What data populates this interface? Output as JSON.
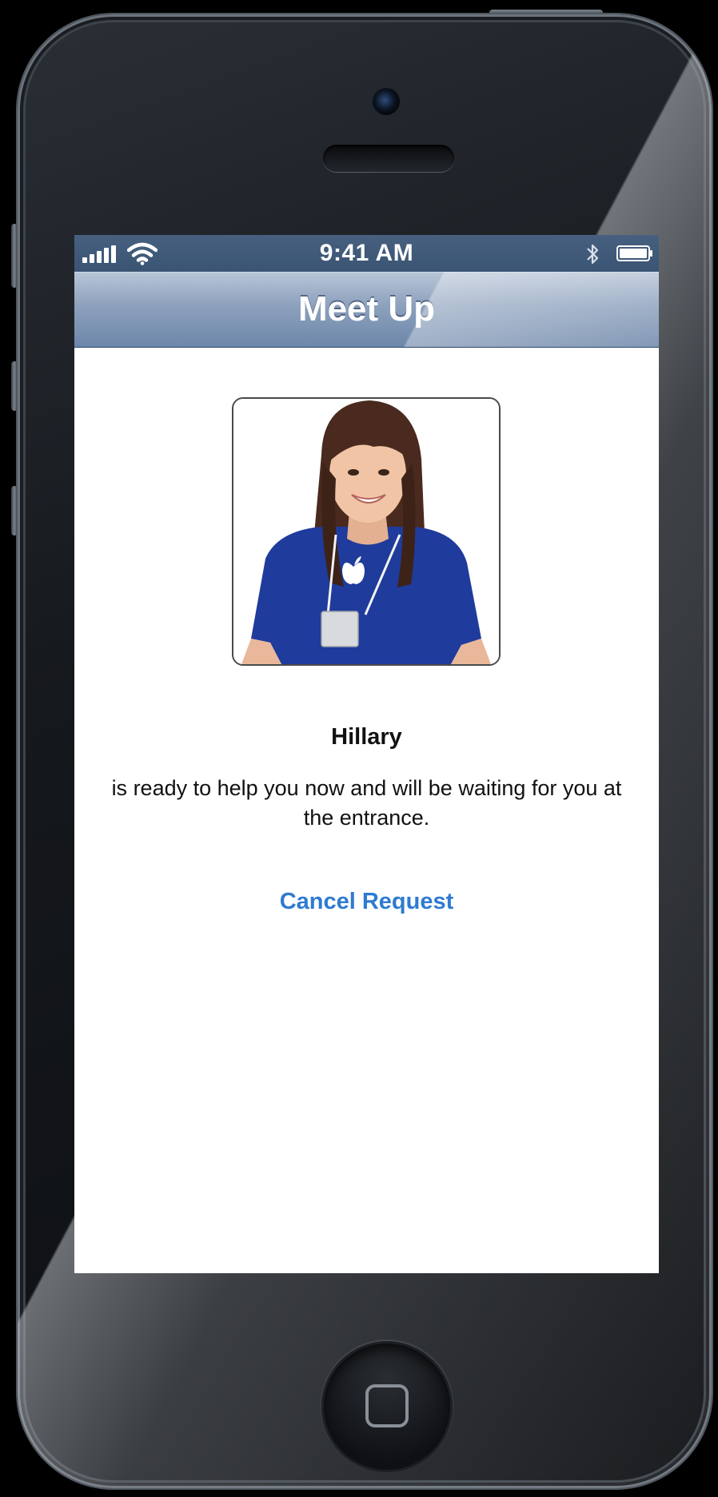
{
  "status_bar": {
    "time": "9:41 AM",
    "signal_icon": "signal-bars-icon",
    "wifi_icon": "wifi-icon",
    "bluetooth_icon": "bluetooth-icon",
    "battery_icon": "battery-icon"
  },
  "nav": {
    "title": "Meet Up"
  },
  "specialist": {
    "photo_icon": "specialist-photo",
    "name": "Hillary",
    "message": "is ready to help you now and will be waiting for you at the entrance."
  },
  "actions": {
    "cancel_label": "Cancel Request"
  },
  "colors": {
    "link": "#2e7bd0",
    "nav_bar": "#8da1bd",
    "status_bar": "#3a5474",
    "shirt": "#1f3b9b"
  }
}
